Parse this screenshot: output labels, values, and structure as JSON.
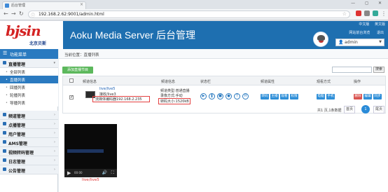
{
  "browser": {
    "tab_title": "后台管理",
    "url": "192.168.2.62:9001/admin.html",
    "win_controls": "— ◻ ✕"
  },
  "header": {
    "logo": "bjsin",
    "logo_sub": "北京贝斯",
    "title": "Aoku Media Server 后台管理",
    "links": [
      "中文版",
      "英文版"
    ],
    "sub_links": [
      "网站前台浏览",
      "退出"
    ],
    "user": "admin"
  },
  "sidebar": {
    "title": "功能菜单",
    "groups": [
      {
        "label": "直播管理",
        "items": [
          "全部列表",
          "直播列表",
          "回播列表",
          "轮播列表",
          "导播列表"
        ],
        "active": 1
      },
      {
        "label": "频道管理"
      },
      {
        "label": "点播管理"
      },
      {
        "label": "用户管理"
      },
      {
        "label": "AMS管理"
      },
      {
        "label": "视频转码管理"
      },
      {
        "label": "日志管理"
      },
      {
        "label": "公告管理"
      }
    ]
  },
  "main": {
    "breadcrumb": "当前位置：直播列表",
    "add_button": "添加直播节目",
    "search_button": "搜索",
    "columns": [
      "频道信息",
      "频道信息",
      "状态栏",
      "频道属性",
      "观看方式",
      "操作"
    ],
    "row": {
      "channel_name": "live/live5",
      "recorder": "接收/live3",
      "source": "流媒体编码器192.168.2.235",
      "type": "频道类型:普通直播",
      "record": "录像方式:手动",
      "size": "转码大小:1520kB",
      "props": [
        "转码",
        "主播",
        "观看",
        "权限"
      ],
      "watch": [
        "电脑",
        "手机"
      ],
      "ops": [
        "删除",
        "编辑",
        "同步"
      ]
    },
    "pager": {
      "summary": "共1 页,1条数据",
      "first": "首页",
      "current": "1",
      "last": "尾页"
    }
  },
  "video": {
    "caption": "live/live5",
    "time": "00:00"
  },
  "colors": {
    "header_blue": "#1e6fb0",
    "sidebar_active": "#2a7ac0",
    "add_green": "#5cb85c",
    "logo_red": "#d42323"
  }
}
